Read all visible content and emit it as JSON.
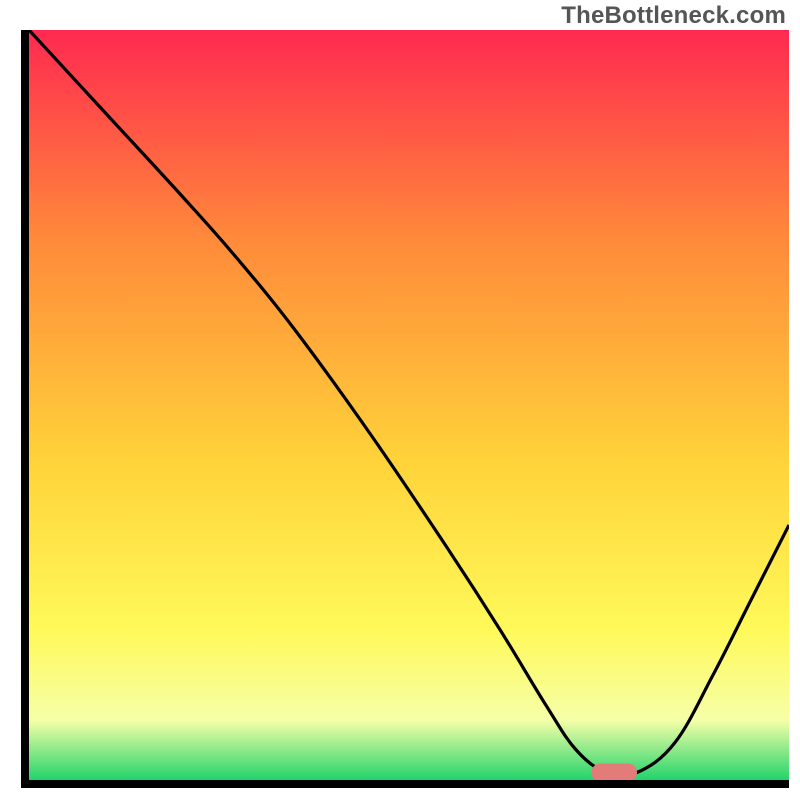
{
  "watermark": "TheBottleneck.com",
  "chart_data": {
    "type": "line",
    "title": "",
    "xlabel": "",
    "ylabel": "",
    "xlim": [
      0,
      100
    ],
    "ylim": [
      0,
      100
    ],
    "grid": false,
    "legend": false,
    "gradient_colors": {
      "top": "#ff2950",
      "upper_mid": "#ff8a3a",
      "mid": "#ffd43a",
      "lower_mid": "#fff95a",
      "near_bottom": "#f6ffa8",
      "bottom": "#23d36b"
    },
    "series": [
      {
        "name": "bottleneck-curve",
        "color": "#000000",
        "x": [
          0,
          10,
          20,
          27,
          35,
          45,
          55,
          62,
          68,
          72,
          76,
          80,
          85,
          90,
          95,
          100
        ],
        "y": [
          100,
          89,
          78,
          70,
          60,
          46,
          31,
          20,
          10,
          4,
          1,
          1,
          5,
          14,
          24,
          34
        ]
      }
    ],
    "marker": {
      "name": "optimal-marker",
      "color": "#e37b7a",
      "x": 77,
      "y": 1,
      "width": 6,
      "height": 2.4,
      "rx": 1.2
    }
  }
}
